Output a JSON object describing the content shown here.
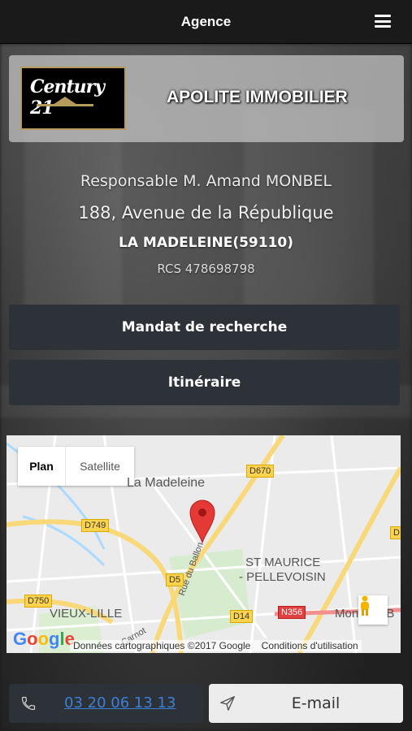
{
  "header": {
    "title": "Agence",
    "menu_icon": "hamburger-menu-icon"
  },
  "agency": {
    "logo_text": "CENTURY 21",
    "name": "APOLITE IMMOBILIER",
    "responsable": "Responsable M. Amand MONBEL",
    "address": "188, Avenue de la République",
    "city": "LA MADELEINE(59110)",
    "rcs": "RCS 478698798"
  },
  "actions": {
    "mandat_label": "Mandat de recherche",
    "itineraire_label": "Itinéraire"
  },
  "map": {
    "type_plan": "Plan",
    "type_satellite": "Satellite",
    "labels": {
      "la_madeleine": "La Madeleine",
      "st_maurice": "ST MAURICE",
      "pellevoisin": "- PELLEVOISIN",
      "vieux_lille": "VIEUX-LILLE",
      "rue_du_ballon": "Rue du Ballon",
      "carnot": "Carnot",
      "mons": "Mons-en-B"
    },
    "roads": {
      "d670": "D670",
      "d749": "D749",
      "d5": "D5",
      "d750": "D750",
      "d14": "D14",
      "n356": "N356",
      "d_edge": "D"
    },
    "google_logo": "Google",
    "footer_data": "Données cartographiques ©2017 Google",
    "footer_terms": "Conditions d'utilisation"
  },
  "contact": {
    "phone": "03 20 06 13 13",
    "email_label": "E-mail"
  },
  "colors": {
    "button_bg": "#2c3238",
    "link": "#3e7fd6",
    "marker": "#e53935"
  }
}
